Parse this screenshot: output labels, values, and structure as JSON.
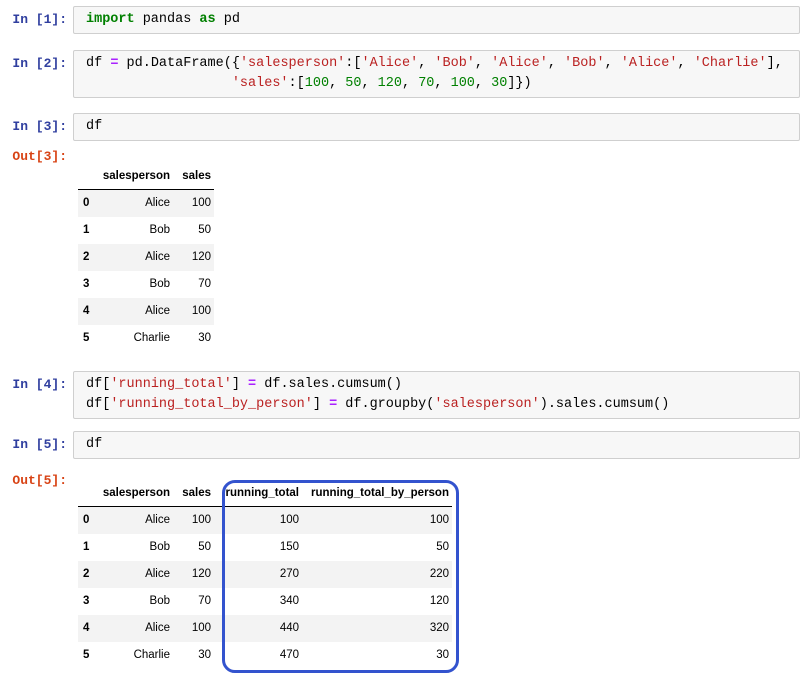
{
  "app": {
    "kind": "jupyter-notebook"
  },
  "colors": {
    "in_prompt": "#303F9F",
    "out_prompt": "#D84315",
    "keyword": "#008000",
    "string": "#BA2121",
    "number": "#008000",
    "operator": "#AA22FF",
    "cell_background": "#F7F7F7",
    "cell_border": "#CFCFCF",
    "row_stripe": "#F3F3F3",
    "annotation_blue": "#3353CE"
  },
  "notebook": {
    "cells": [
      {
        "kind": "code",
        "prompt": "In [1]:",
        "lines": [
          [
            [
              "kw",
              "import"
            ],
            [
              "pl",
              " pandas "
            ],
            [
              "kw",
              "as"
            ],
            [
              "pl",
              " pd"
            ]
          ]
        ]
      },
      {
        "kind": "code",
        "prompt": "In [2]:",
        "lines": [
          [
            [
              "pl",
              "df "
            ],
            [
              "op",
              "="
            ],
            [
              "pl",
              " pd.DataFrame({"
            ],
            [
              "str",
              "'salesperson'"
            ],
            [
              "pl",
              ":["
            ],
            [
              "str",
              "'Alice'"
            ],
            [
              "pl",
              ", "
            ],
            [
              "str",
              "'Bob'"
            ],
            [
              "pl",
              ", "
            ],
            [
              "str",
              "'Alice'"
            ],
            [
              "pl",
              ", "
            ],
            [
              "str",
              "'Bob'"
            ],
            [
              "pl",
              ", "
            ],
            [
              "str",
              "'Alice'"
            ],
            [
              "pl",
              ", "
            ],
            [
              "str",
              "'Charlie'"
            ],
            [
              "pl",
              "],"
            ]
          ],
          [
            [
              "pl",
              "                  "
            ],
            [
              "str",
              "'sales'"
            ],
            [
              "pl",
              ":["
            ],
            [
              "num",
              "100"
            ],
            [
              "pl",
              ", "
            ],
            [
              "num",
              "50"
            ],
            [
              "pl",
              ", "
            ],
            [
              "num",
              "120"
            ],
            [
              "pl",
              ", "
            ],
            [
              "num",
              "70"
            ],
            [
              "pl",
              ", "
            ],
            [
              "num",
              "100"
            ],
            [
              "pl",
              ", "
            ],
            [
              "num",
              "30"
            ],
            [
              "pl",
              "]})"
            ]
          ]
        ]
      },
      {
        "kind": "code",
        "prompt": "In [3]:",
        "lines": [
          [
            [
              "pl",
              "df"
            ]
          ]
        ]
      },
      {
        "kind": "output",
        "prompt": "Out[3]:",
        "table": {
          "index_header": "",
          "columns": [
            "salesperson",
            "sales"
          ],
          "index": [
            "0",
            "1",
            "2",
            "3",
            "4",
            "5"
          ],
          "rows": [
            [
              "Alice",
              "100"
            ],
            [
              "Bob",
              "50"
            ],
            [
              "Alice",
              "120"
            ],
            [
              "Bob",
              "70"
            ],
            [
              "Alice",
              "100"
            ],
            [
              "Charlie",
              "30"
            ]
          ]
        }
      },
      {
        "kind": "code",
        "prompt": "In [4]:",
        "lines": [
          [
            [
              "pl",
              "df["
            ],
            [
              "str",
              "'running_total'"
            ],
            [
              "pl",
              "] "
            ],
            [
              "op",
              "="
            ],
            [
              "pl",
              " df.sales.cumsum()"
            ]
          ],
          [
            [
              "pl",
              "df["
            ],
            [
              "str",
              "'running_total_by_person'"
            ],
            [
              "pl",
              "] "
            ],
            [
              "op",
              "="
            ],
            [
              "pl",
              " df.groupby("
            ],
            [
              "str",
              "'salesperson'"
            ],
            [
              "pl",
              ").sales.cumsum()"
            ]
          ]
        ]
      },
      {
        "kind": "code",
        "prompt": "In [5]:",
        "lines": [
          [
            [
              "pl",
              "df"
            ]
          ]
        ]
      },
      {
        "kind": "output",
        "prompt": "Out[5]:",
        "table": {
          "index_header": "",
          "columns": [
            "salesperson",
            "sales",
            "running_total",
            "running_total_by_person"
          ],
          "index": [
            "0",
            "1",
            "2",
            "3",
            "4",
            "5"
          ],
          "rows": [
            [
              "Alice",
              "100",
              "100",
              "100"
            ],
            [
              "Bob",
              "50",
              "150",
              "50"
            ],
            [
              "Alice",
              "120",
              "270",
              "220"
            ],
            [
              "Bob",
              "70",
              "340",
              "120"
            ],
            [
              "Alice",
              "100",
              "440",
              "320"
            ],
            [
              "Charlie",
              "30",
              "470",
              "30"
            ]
          ],
          "annotation": {
            "name": "highlight-new-columns",
            "columns_highlighted": [
              "running_total",
              "running_total_by_person"
            ],
            "color": "#3353CE"
          }
        }
      }
    ]
  }
}
